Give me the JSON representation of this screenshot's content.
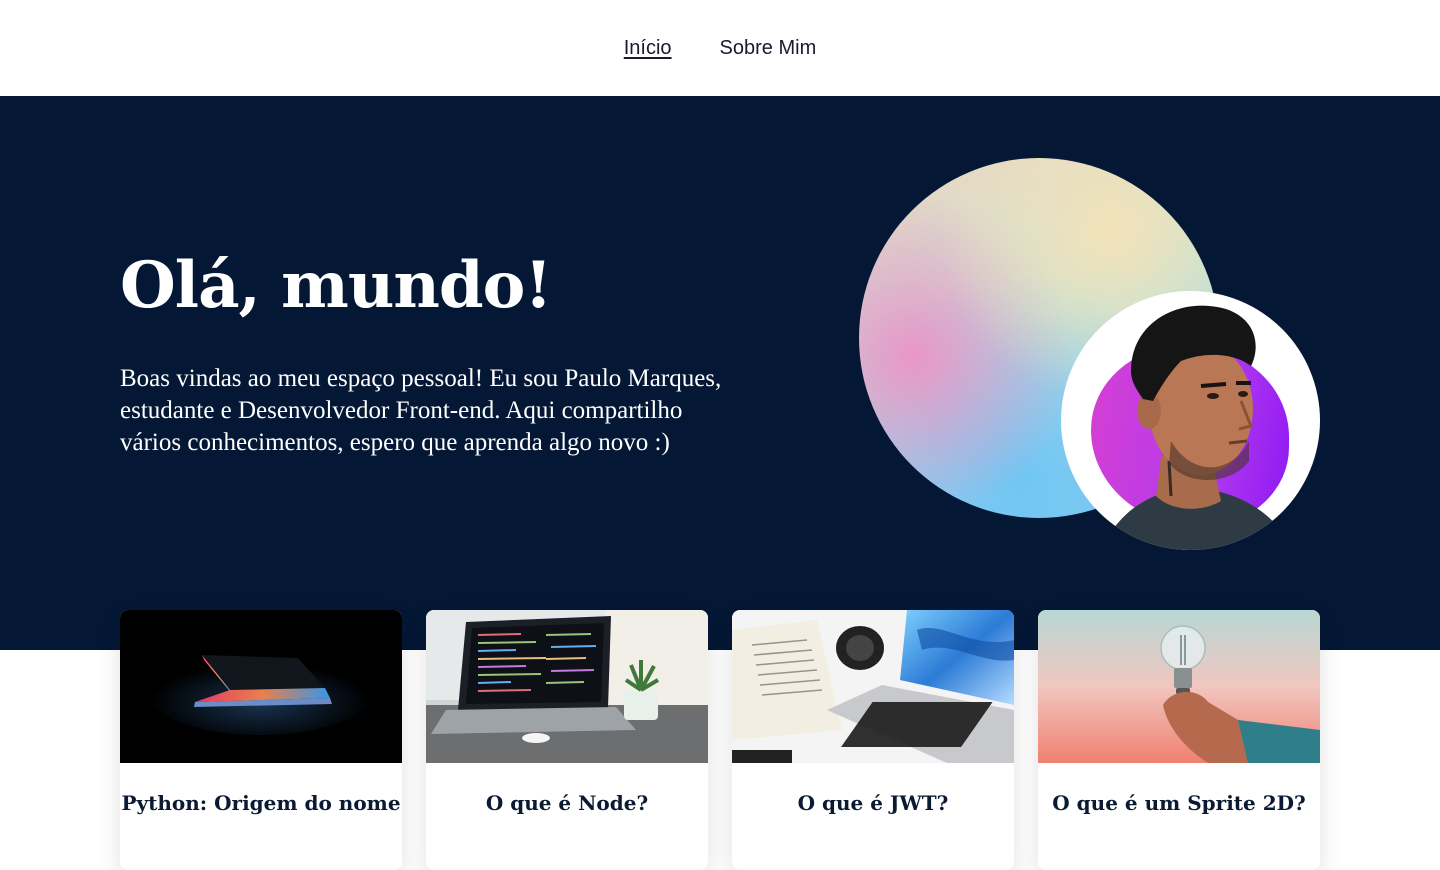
{
  "nav": {
    "items": [
      {
        "label": "Início",
        "active": true
      },
      {
        "label": "Sobre Mim",
        "active": false
      }
    ]
  },
  "hero": {
    "title": "Olá, mundo!",
    "description": "Boas vindas ao meu espaço pessoal! Eu sou Paulo Marques, estudante e Desenvolvedor Front-end. Aqui compartilho vários conhecimentos, espero que aprenda algo novo :)"
  },
  "colors": {
    "hero_bg": "#041836",
    "avatar_blob": "#b23af0",
    "text_dark": "#0b1a33"
  },
  "cards": [
    {
      "title": "Python: Origem do nome",
      "image": "laptop-dark-icon"
    },
    {
      "title": "O que é Node?",
      "image": "code-laptop-icon"
    },
    {
      "title": "O que é JWT?",
      "image": "desk-laptop-icon"
    },
    {
      "title": "O que é um Sprite 2D?",
      "image": "lightbulb-icon"
    }
  ]
}
